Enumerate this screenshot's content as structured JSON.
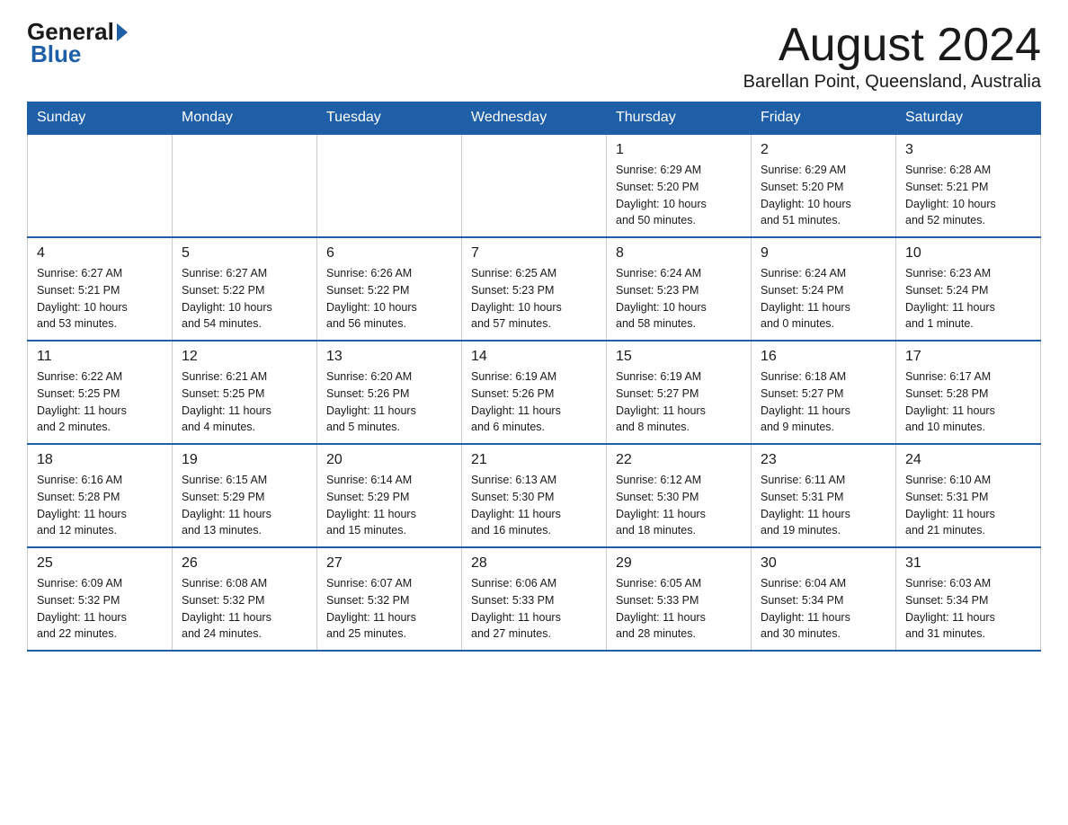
{
  "logo": {
    "general_text": "General",
    "blue_text": "Blue"
  },
  "header": {
    "month_title": "August 2024",
    "subtitle": "Barellan Point, Queensland, Australia"
  },
  "days_of_week": [
    "Sunday",
    "Monday",
    "Tuesday",
    "Wednesday",
    "Thursday",
    "Friday",
    "Saturday"
  ],
  "weeks": [
    [
      {
        "day": "",
        "info": ""
      },
      {
        "day": "",
        "info": ""
      },
      {
        "day": "",
        "info": ""
      },
      {
        "day": "",
        "info": ""
      },
      {
        "day": "1",
        "info": "Sunrise: 6:29 AM\nSunset: 5:20 PM\nDaylight: 10 hours\nand 50 minutes."
      },
      {
        "day": "2",
        "info": "Sunrise: 6:29 AM\nSunset: 5:20 PM\nDaylight: 10 hours\nand 51 minutes."
      },
      {
        "day": "3",
        "info": "Sunrise: 6:28 AM\nSunset: 5:21 PM\nDaylight: 10 hours\nand 52 minutes."
      }
    ],
    [
      {
        "day": "4",
        "info": "Sunrise: 6:27 AM\nSunset: 5:21 PM\nDaylight: 10 hours\nand 53 minutes."
      },
      {
        "day": "5",
        "info": "Sunrise: 6:27 AM\nSunset: 5:22 PM\nDaylight: 10 hours\nand 54 minutes."
      },
      {
        "day": "6",
        "info": "Sunrise: 6:26 AM\nSunset: 5:22 PM\nDaylight: 10 hours\nand 56 minutes."
      },
      {
        "day": "7",
        "info": "Sunrise: 6:25 AM\nSunset: 5:23 PM\nDaylight: 10 hours\nand 57 minutes."
      },
      {
        "day": "8",
        "info": "Sunrise: 6:24 AM\nSunset: 5:23 PM\nDaylight: 10 hours\nand 58 minutes."
      },
      {
        "day": "9",
        "info": "Sunrise: 6:24 AM\nSunset: 5:24 PM\nDaylight: 11 hours\nand 0 minutes."
      },
      {
        "day": "10",
        "info": "Sunrise: 6:23 AM\nSunset: 5:24 PM\nDaylight: 11 hours\nand 1 minute."
      }
    ],
    [
      {
        "day": "11",
        "info": "Sunrise: 6:22 AM\nSunset: 5:25 PM\nDaylight: 11 hours\nand 2 minutes."
      },
      {
        "day": "12",
        "info": "Sunrise: 6:21 AM\nSunset: 5:25 PM\nDaylight: 11 hours\nand 4 minutes."
      },
      {
        "day": "13",
        "info": "Sunrise: 6:20 AM\nSunset: 5:26 PM\nDaylight: 11 hours\nand 5 minutes."
      },
      {
        "day": "14",
        "info": "Sunrise: 6:19 AM\nSunset: 5:26 PM\nDaylight: 11 hours\nand 6 minutes."
      },
      {
        "day": "15",
        "info": "Sunrise: 6:19 AM\nSunset: 5:27 PM\nDaylight: 11 hours\nand 8 minutes."
      },
      {
        "day": "16",
        "info": "Sunrise: 6:18 AM\nSunset: 5:27 PM\nDaylight: 11 hours\nand 9 minutes."
      },
      {
        "day": "17",
        "info": "Sunrise: 6:17 AM\nSunset: 5:28 PM\nDaylight: 11 hours\nand 10 minutes."
      }
    ],
    [
      {
        "day": "18",
        "info": "Sunrise: 6:16 AM\nSunset: 5:28 PM\nDaylight: 11 hours\nand 12 minutes."
      },
      {
        "day": "19",
        "info": "Sunrise: 6:15 AM\nSunset: 5:29 PM\nDaylight: 11 hours\nand 13 minutes."
      },
      {
        "day": "20",
        "info": "Sunrise: 6:14 AM\nSunset: 5:29 PM\nDaylight: 11 hours\nand 15 minutes."
      },
      {
        "day": "21",
        "info": "Sunrise: 6:13 AM\nSunset: 5:30 PM\nDaylight: 11 hours\nand 16 minutes."
      },
      {
        "day": "22",
        "info": "Sunrise: 6:12 AM\nSunset: 5:30 PM\nDaylight: 11 hours\nand 18 minutes."
      },
      {
        "day": "23",
        "info": "Sunrise: 6:11 AM\nSunset: 5:31 PM\nDaylight: 11 hours\nand 19 minutes."
      },
      {
        "day": "24",
        "info": "Sunrise: 6:10 AM\nSunset: 5:31 PM\nDaylight: 11 hours\nand 21 minutes."
      }
    ],
    [
      {
        "day": "25",
        "info": "Sunrise: 6:09 AM\nSunset: 5:32 PM\nDaylight: 11 hours\nand 22 minutes."
      },
      {
        "day": "26",
        "info": "Sunrise: 6:08 AM\nSunset: 5:32 PM\nDaylight: 11 hours\nand 24 minutes."
      },
      {
        "day": "27",
        "info": "Sunrise: 6:07 AM\nSunset: 5:32 PM\nDaylight: 11 hours\nand 25 minutes."
      },
      {
        "day": "28",
        "info": "Sunrise: 6:06 AM\nSunset: 5:33 PM\nDaylight: 11 hours\nand 27 minutes."
      },
      {
        "day": "29",
        "info": "Sunrise: 6:05 AM\nSunset: 5:33 PM\nDaylight: 11 hours\nand 28 minutes."
      },
      {
        "day": "30",
        "info": "Sunrise: 6:04 AM\nSunset: 5:34 PM\nDaylight: 11 hours\nand 30 minutes."
      },
      {
        "day": "31",
        "info": "Sunrise: 6:03 AM\nSunset: 5:34 PM\nDaylight: 11 hours\nand 31 minutes."
      }
    ]
  ]
}
